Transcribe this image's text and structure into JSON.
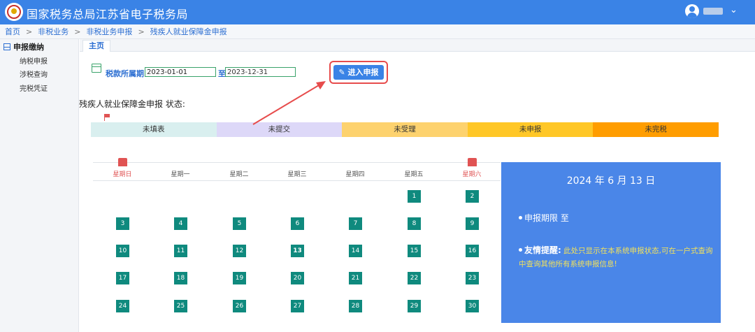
{
  "header": {
    "title": "国家税务总局江苏省电子税务局",
    "user_menu_icon": "chevron-down-icon"
  },
  "breadcrumb": [
    "首页",
    "非税业务",
    "非税业务申报",
    "残疾人就业保障金申报"
  ],
  "sidebar": {
    "section_label": "申报缴纳",
    "items": [
      {
        "label": "纳税申报"
      },
      {
        "label": "涉税查询"
      },
      {
        "label": "完税凭证"
      }
    ]
  },
  "tabs": [
    {
      "label": "主页"
    }
  ],
  "period": {
    "label": "税款所属期:",
    "start": "2023-01-01",
    "to": "至",
    "end": "2023-12-31"
  },
  "enter_button": {
    "label": "进入申报",
    "icon": "edit-icon"
  },
  "status": {
    "title": "残疾人就业保障金申报 状态:",
    "segments": [
      {
        "label": "未填表",
        "color": "#d9efef"
      },
      {
        "label": "未提交",
        "color": "#ddd8f8"
      },
      {
        "label": "未受理",
        "color": "#fdd26e"
      },
      {
        "label": "未申报",
        "color": "#ffc727"
      },
      {
        "label": "未完税",
        "color": "#ff9d00"
      }
    ]
  },
  "calendar": {
    "weekdays": [
      "星期日",
      "星期一",
      "星期二",
      "星期三",
      "星期四",
      "星期五",
      "星期六"
    ],
    "weeks": [
      [
        null,
        null,
        null,
        null,
        null,
        1,
        2
      ],
      [
        3,
        4,
        5,
        6,
        7,
        8,
        9
      ],
      [
        10,
        11,
        12,
        13,
        14,
        15,
        16
      ],
      [
        17,
        18,
        19,
        20,
        21,
        22,
        23
      ],
      [
        24,
        25,
        26,
        27,
        28,
        29,
        30
      ]
    ],
    "today": 13
  },
  "info": {
    "date": "2024 年 6 月 13 日",
    "deadline": "申报期限   至",
    "tip_label": "友情提醒:",
    "tip_text": "此处只显示在本系统申报状态,可在一户式查询中查询其他所有系统申报信息!"
  },
  "colors": {
    "accent": "#3a83e6",
    "day_cell": "#0f8a7e",
    "info_panel": "#4a86e8",
    "weekend": "#e05353",
    "annotation": "#e74c4c"
  }
}
